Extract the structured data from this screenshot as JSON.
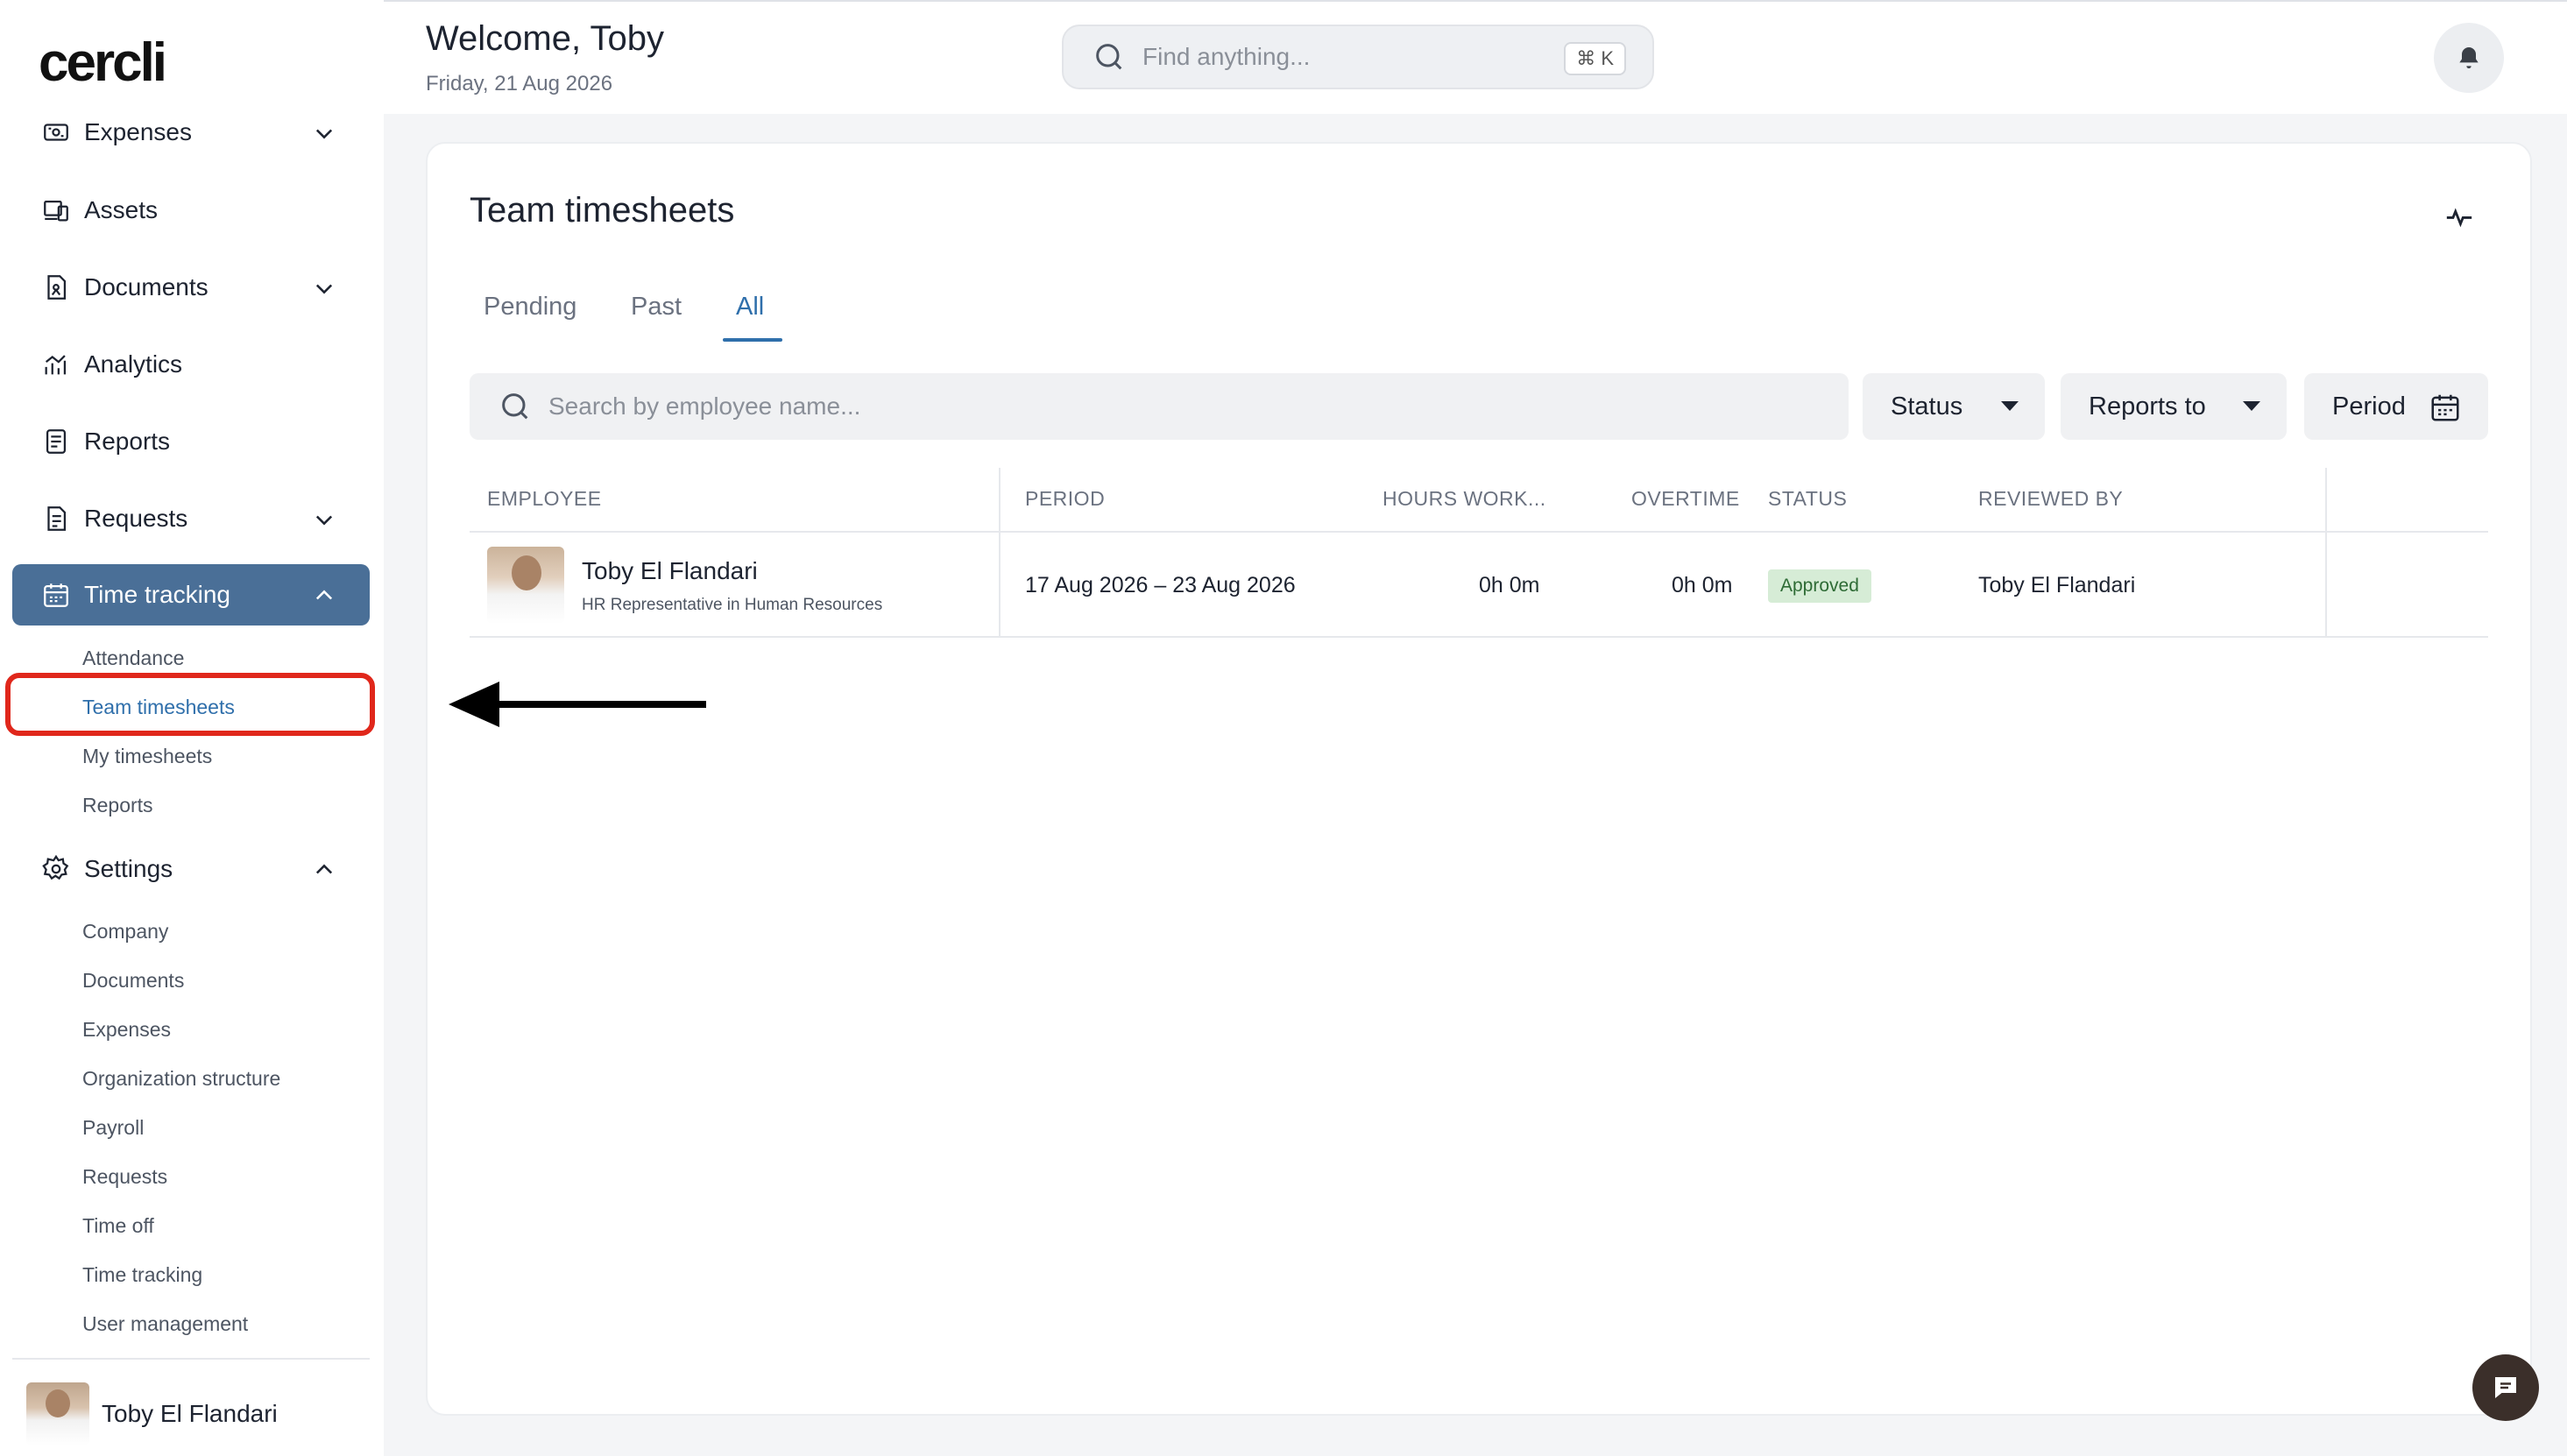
{
  "app": {
    "logo_text": "cercli"
  },
  "sidebar": {
    "items": [
      {
        "label": "Expenses",
        "icon": "expenses-icon",
        "expandable": true
      },
      {
        "label": "Assets",
        "icon": "assets-icon",
        "expandable": false
      },
      {
        "label": "Documents",
        "icon": "documents-icon",
        "expandable": true
      },
      {
        "label": "Analytics",
        "icon": "analytics-icon",
        "expandable": false
      },
      {
        "label": "Reports",
        "icon": "reports-icon",
        "expandable": false
      },
      {
        "label": "Requests",
        "icon": "requests-icon",
        "expandable": true
      },
      {
        "label": "Time tracking",
        "icon": "calendar-icon",
        "expandable": true,
        "active": true
      }
    ],
    "time_tracking_sub": [
      "Attendance",
      "Team timesheets",
      "My timesheets",
      "Reports"
    ],
    "settings_label": "Settings",
    "settings_sub": [
      "Company",
      "Documents",
      "Expenses",
      "Organization structure",
      "Payroll",
      "Requests",
      "Time off",
      "Time tracking",
      "User management"
    ],
    "user_name": "Toby El Flandari"
  },
  "header": {
    "welcome": "Welcome, Toby",
    "date": "Friday, 21 Aug 2026",
    "search_placeholder": "Find anything...",
    "shortcut": "⌘ K"
  },
  "page": {
    "title": "Team timesheets",
    "tabs": [
      {
        "label": "Pending"
      },
      {
        "label": "Past"
      },
      {
        "label": "All",
        "active": true
      }
    ],
    "search_placeholder": "Search by employee name...",
    "filters": {
      "status": "Status",
      "reports_to": "Reports to",
      "period": "Period"
    },
    "table": {
      "headers": [
        "EMPLOYEE",
        "PERIOD",
        "HOURS WORK...",
        "OVERTIME",
        "STATUS",
        "REVIEWED BY"
      ],
      "rows": [
        {
          "employee": "Toby El Flandari",
          "role": "HR Representative in Human Resources",
          "period": "17 Aug 2026 – 23 Aug 2026",
          "hours": "0h 0m",
          "overtime": "0h 0m",
          "status": "Approved",
          "reviewed_by": "Toby El Flandari"
        }
      ]
    }
  },
  "colors": {
    "accent": "#2f6fab",
    "active_nav": "#4a6f97",
    "highlight": "#e0271b",
    "approved_bg": "#d6ecd6"
  }
}
